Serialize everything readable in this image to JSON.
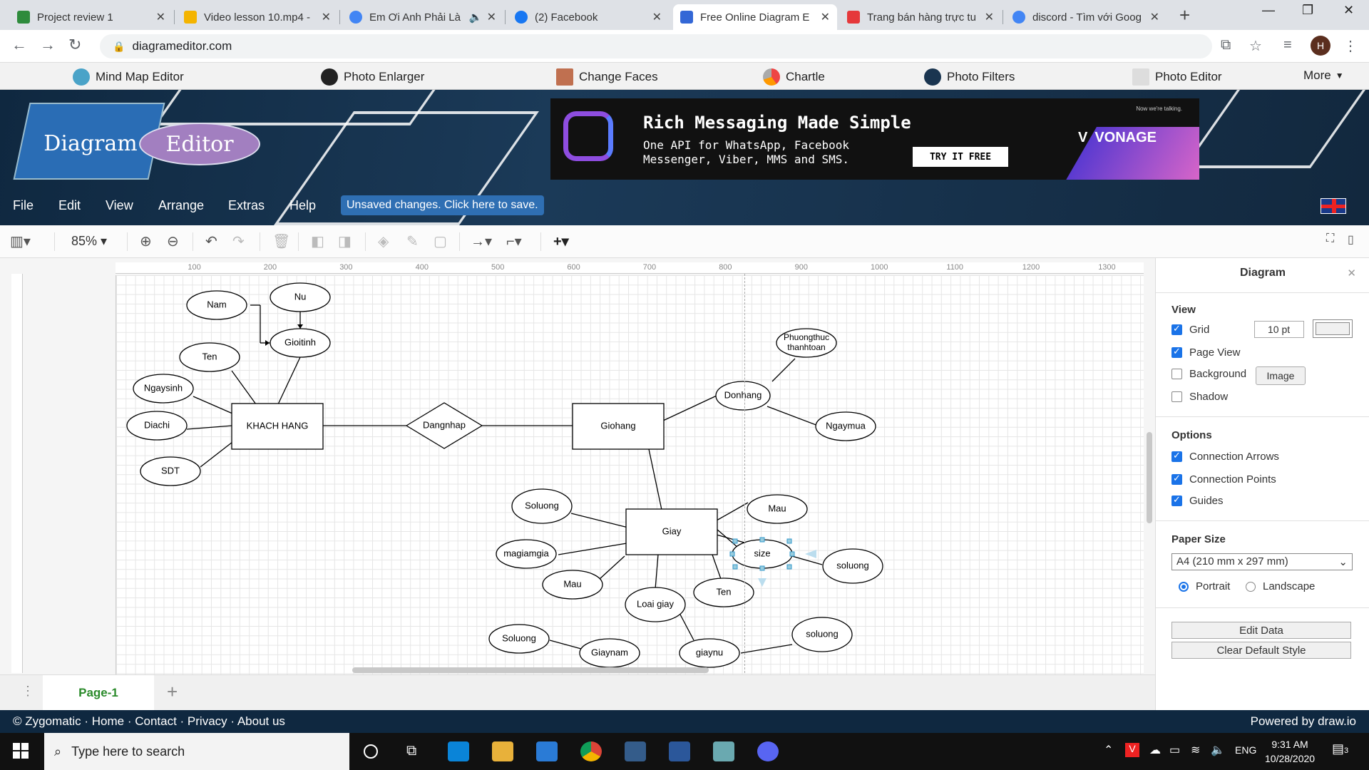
{
  "tabs": [
    {
      "title": "Project review 1",
      "color": "#2e8b3c"
    },
    {
      "title": "Video lesson 10.mp4 - ",
      "color": "#f4b400"
    },
    {
      "title": "Em Ơi Anh Phải Là",
      "color": "#4285f4"
    },
    {
      "title": "(2) Facebook",
      "color": "#1877f2"
    },
    {
      "title": "Free Online Diagram E",
      "color": "#3367d6"
    },
    {
      "title": "Trang bán hàng trực tu",
      "color": "#e5383b"
    },
    {
      "title": "discord - Tìm với Goog",
      "color": "#4285f4"
    }
  ],
  "address": {
    "url": "diagrameditor.com",
    "profile": "H"
  },
  "site_nav": [
    "Mind Map Editor",
    "Photo Enlarger",
    "Change Faces",
    "Chartle",
    "Photo Filters",
    "Photo Editor",
    "More"
  ],
  "logo": {
    "part1": "Diagram",
    "part2": "Editor"
  },
  "ad": {
    "headline": "Rich Messaging Made Simple",
    "sub": "One API for WhatsApp, Facebook Messenger, Viber, MMS and SMS.",
    "cta": "TRY IT FREE",
    "brand": "VONAGE",
    "tag": "Now we're talking."
  },
  "menu": [
    "File",
    "Edit",
    "View",
    "Arrange",
    "Extras",
    "Help"
  ],
  "unsaved": "Unsaved changes. Click here to save.",
  "toolbar": {
    "zoom": "85%"
  },
  "ruler": [
    "100",
    "200",
    "300",
    "400",
    "500",
    "600",
    "700",
    "800",
    "900",
    "1000",
    "1100",
    "1200",
    "1300"
  ],
  "diagram": {
    "entities": [
      "KHACH HANG",
      "Giohang",
      "Giay"
    ],
    "relationship": "Dangnhap",
    "attributes": [
      "Nam",
      "Nu",
      "Gioitinh",
      "Ten",
      "Ngaysinh",
      "Diachi",
      "SDT",
      "Donhang",
      "Phuongthuc",
      "thanhtoan",
      "Ngaymua",
      "Soluong",
      "Mau",
      "size",
      "soluong",
      "magiamgia",
      "Mau",
      "Ten",
      "Loai giay",
      "Soluong",
      "Giaynam",
      "giaynu",
      "soluong"
    ]
  },
  "pages": {
    "current": "Page-1"
  },
  "panel": {
    "title": "Diagram",
    "view_label": "View",
    "grid": "Grid",
    "grid_size": "10 pt",
    "page_view": "Page View",
    "background": "Background",
    "image_btn": "Image",
    "shadow": "Shadow",
    "options_label": "Options",
    "conn_arrows": "Connection Arrows",
    "conn_points": "Connection Points",
    "guides": "Guides",
    "paper_label": "Paper Size",
    "paper_value": "A4 (210 mm x 297 mm)",
    "portrait": "Portrait",
    "landscape": "Landscape",
    "edit_data": "Edit Data",
    "clear_style": "Clear Default Style"
  },
  "footer": {
    "left": "© Zygomatic · Home · Contact · Privacy · About us",
    "right": "Powered by  draw.io"
  },
  "taskbar": {
    "search": "Type here to search",
    "lang": "ENG",
    "time": "9:31 AM",
    "date": "10/28/2020",
    "notif": "3"
  }
}
